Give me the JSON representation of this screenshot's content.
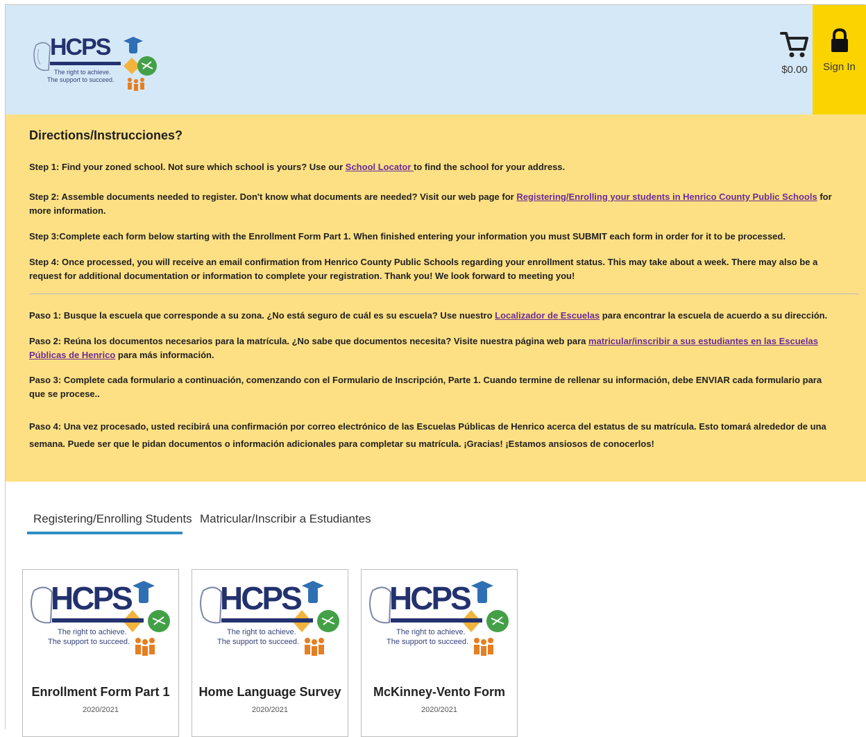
{
  "header": {
    "logo": {
      "word": "HCPS",
      "tagline1": "The right to achieve.",
      "tagline2": "The support to succeed."
    },
    "cart": {
      "icon": "cart-icon",
      "price": "$0.00"
    },
    "signin": {
      "icon": "lock-icon",
      "label": "Sign In"
    }
  },
  "directions": {
    "title": "Directions/Instrucciones?",
    "step1": {
      "before": "Step 1: Find your zoned school. Not sure which school is yours? Use our ",
      "link": "School Locator ",
      "after": " to find the school for your address."
    },
    "step2": {
      "before": "Step 2: Assemble documents needed to register. Don't know what documents are needed? Visit our web page for ",
      "link": "Registering/Enrolling your students in Henrico County Public Schools",
      "after": " for more information."
    },
    "step3": "Step 3:Complete each form below starting with the Enrollment Form Part 1.  When finished entering your information you must SUBMIT each form in order for it to be processed.",
    "step4": "Step 4: Once processed, you will receive an email confirmation from Henrico County Public Schools regarding your enrollment status. This may take about a week. There may also be a request for additional documentation or information to complete your registration. Thank you! We look forward to meeting you!",
    "paso1": {
      "before": "Paso 1: Busque la escuela que corresponde a su zona.  ¿No está seguro de cuál es su escuela? Use nuestro ",
      "link": "Localizador de Escuelas",
      "after": " para encontrar la escuela de acuerdo a su dirección."
    },
    "paso2": {
      "before": "Paso 2: Reúna los documentos necesarios para la matrícula.  ¿No sabe que documentos necesita? Visite nuestra página web para ",
      "link": "matricular/inscribir a sus estudiantes en las Escuelas Públicas de Henrico",
      "after": " para más información."
    },
    "paso3": "Paso 3: Complete cada formulario a continuación, comenzando con el Formulario de Inscripción, Parte 1. Cuando termine de rellenar su información, debe ENVIAR cada formulario para que se procese..",
    "paso4": "Paso 4: Una vez procesado, usted recibirá una confirmación por correo electrónico de las Escuelas Públicas de Henrico acerca del estatus de su matrícula.  Esto tomará alrededor de una semana. Puede ser que le pidan documentos o información adicionales para completar su matrícula. ¡Gracias! ¡Estamos ansiosos de conocerlos!"
  },
  "tabs": [
    {
      "label": "Registering/Enrolling Students",
      "active": true
    },
    {
      "label": "Matricular/Inscribir a Estudiantes",
      "active": false
    }
  ],
  "cards": [
    {
      "title": "Enrollment Form Part 1",
      "year": "2020/2021"
    },
    {
      "title": "Home Language Survey",
      "year": "2020/2021"
    },
    {
      "title": "McKinney-Vento Form",
      "year": "2020/2021"
    }
  ],
  "colors": {
    "header_bg": "#d5e8f7",
    "signin_bg": "#fbd400",
    "directions_bg": "#fde084",
    "link": "#6c2c96",
    "tab_underline": "#2f8ec3",
    "logo_navy": "#23326e"
  }
}
